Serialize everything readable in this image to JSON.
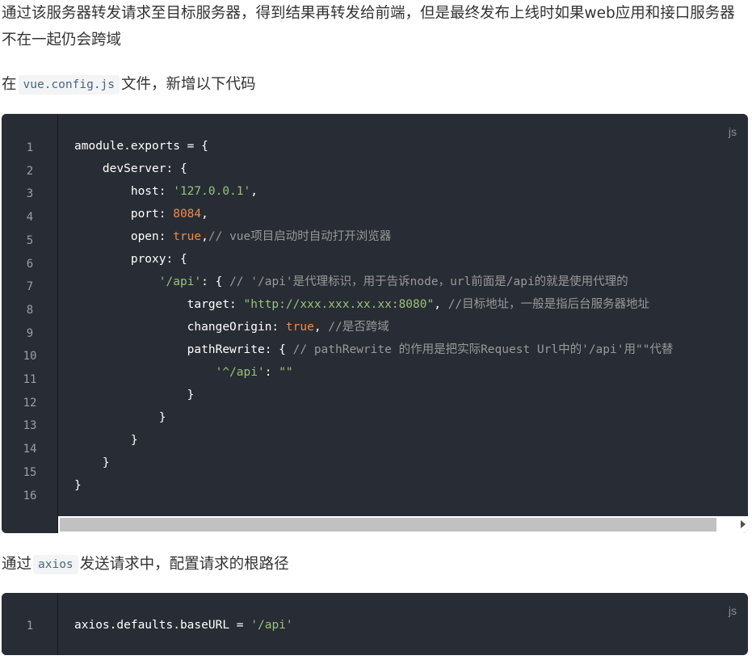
{
  "paragraphs": {
    "intro": "通过该服务器转发请求至目标服务器，得到结果再转发给前端，但是最终发布上线时如果web应用和接口服务器不在一起仍会跨域",
    "config_prefix": "在",
    "config_file": "vue.config.js",
    "config_suffix": "文件，新增以下代码",
    "axios_prefix": "通过",
    "axios_code": "axios",
    "axios_suffix": "发送请求中，配置请求的根路径"
  },
  "code_block_1": {
    "lang": "js",
    "line_numbers": [
      "1",
      "2",
      "3",
      "4",
      "5",
      "6",
      "7",
      "8",
      "9",
      "10",
      "11",
      "12",
      "13",
      "14",
      "15",
      "16"
    ],
    "lines": [
      [
        {
          "t": "amodule.exports = {",
          "c": ""
        }
      ],
      [
        {
          "t": "    devServer: {",
          "c": ""
        }
      ],
      [
        {
          "t": "        host: ",
          "c": ""
        },
        {
          "t": "'127.0.0.1'",
          "c": "str"
        },
        {
          "t": ",",
          "c": ""
        }
      ],
      [
        {
          "t": "        port: ",
          "c": ""
        },
        {
          "t": "8084",
          "c": "num"
        },
        {
          "t": ",",
          "c": ""
        }
      ],
      [
        {
          "t": "        open: ",
          "c": ""
        },
        {
          "t": "true",
          "c": "kw"
        },
        {
          "t": ",",
          "c": ""
        },
        {
          "t": "// vue项目启动时自动打开浏览器",
          "c": "com"
        }
      ],
      [
        {
          "t": "        proxy: {",
          "c": ""
        }
      ],
      [
        {
          "t": "            ",
          "c": ""
        },
        {
          "t": "'/api'",
          "c": "str"
        },
        {
          "t": ": { ",
          "c": ""
        },
        {
          "t": "// '/api'是代理标识，用于告诉node，url前面是/api的就是使用代理的",
          "c": "com"
        }
      ],
      [
        {
          "t": "                target: ",
          "c": ""
        },
        {
          "t": "\"http://xxx.xxx.xx.xx:8080\"",
          "c": "str"
        },
        {
          "t": ", ",
          "c": ""
        },
        {
          "t": "//目标地址，一般是指后台服务器地址",
          "c": "com"
        }
      ],
      [
        {
          "t": "                changeOrigin: ",
          "c": ""
        },
        {
          "t": "true",
          "c": "kw"
        },
        {
          "t": ", ",
          "c": ""
        },
        {
          "t": "//是否跨域",
          "c": "com"
        }
      ],
      [
        {
          "t": "                pathRewrite: { ",
          "c": ""
        },
        {
          "t": "// pathRewrite 的作用是把实际Request Url中的'/api'用\"\"代替",
          "c": "com"
        }
      ],
      [
        {
          "t": "                    ",
          "c": ""
        },
        {
          "t": "'^/api'",
          "c": "str"
        },
        {
          "t": ": ",
          "c": ""
        },
        {
          "t": "\"\"",
          "c": "str"
        }
      ],
      [
        {
          "t": "                }",
          "c": ""
        }
      ],
      [
        {
          "t": "            }",
          "c": ""
        }
      ],
      [
        {
          "t": "        }",
          "c": ""
        }
      ],
      [
        {
          "t": "    }",
          "c": ""
        }
      ],
      [
        {
          "t": "}",
          "c": ""
        }
      ]
    ]
  },
  "code_block_2": {
    "lang": "js",
    "line_numbers": [
      "1"
    ],
    "lines": [
      [
        {
          "t": "axios.defaults.baseURL = ",
          "c": ""
        },
        {
          "t": "'/api'",
          "c": "str"
        }
      ]
    ]
  }
}
